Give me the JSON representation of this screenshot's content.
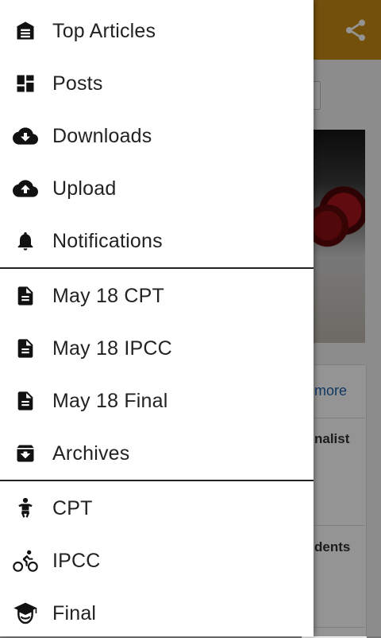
{
  "drawer": {
    "items": [
      {
        "label": "Top Articles",
        "icon": "article-icon"
      },
      {
        "label": "Posts",
        "icon": "dashboard-icon"
      },
      {
        "label": "Downloads",
        "icon": "cloud-download-icon"
      },
      {
        "label": "Upload",
        "icon": "cloud-upload-icon"
      },
      {
        "label": "Notifications",
        "icon": "bell-icon"
      },
      {
        "label": "May 18 CPT",
        "icon": "document-icon"
      },
      {
        "label": "May 18 IPCC",
        "icon": "document-icon"
      },
      {
        "label": "May 18 Final",
        "icon": "document-icon"
      },
      {
        "label": "Archives",
        "icon": "archive-icon"
      },
      {
        "label": "CPT",
        "icon": "baby-icon"
      },
      {
        "label": "IPCC",
        "icon": "bicycle-icon"
      },
      {
        "label": "Final",
        "icon": "graduate-icon"
      }
    ]
  },
  "background": {
    "more_link": "more",
    "row1_text": "nalist",
    "row2_text": "dents"
  },
  "colors": {
    "appbar": "#c98a17",
    "drawer_bg": "#ffffff",
    "text": "#222222",
    "link": "#1e5fa8"
  }
}
